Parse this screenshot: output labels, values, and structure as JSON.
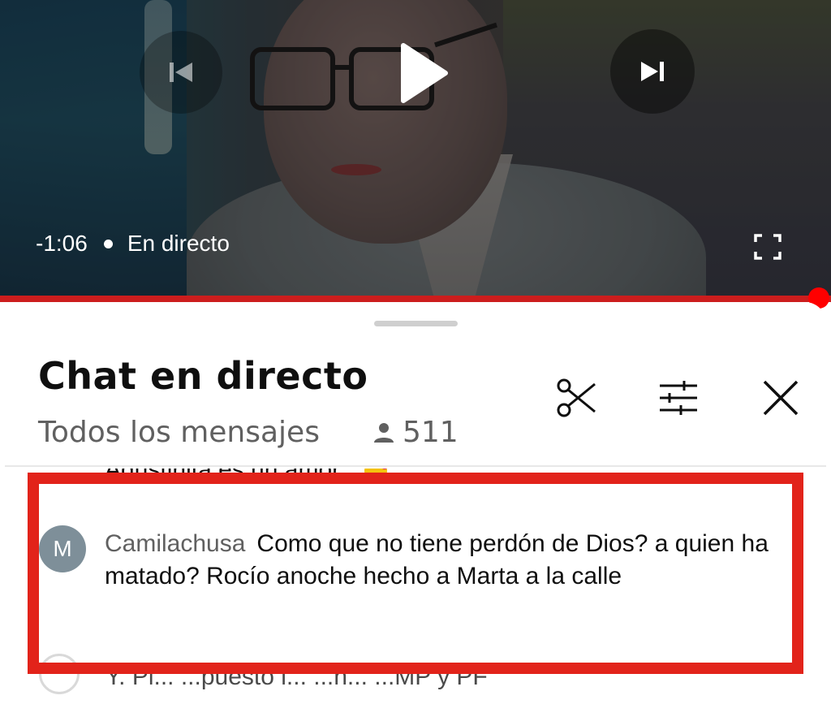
{
  "player": {
    "time_remaining": "-1:06",
    "live_label": "En directo",
    "icons": {
      "prev": "skip-previous-icon",
      "play": "play-icon",
      "next": "skip-next-icon",
      "fullscreen": "fullscreen-icon"
    },
    "progress_color": "#ff0000"
  },
  "chat": {
    "title": "Chat en directo",
    "filter_label": "Todos los mensajes",
    "viewer_count": "511",
    "icons": {
      "viewers": "person-icon",
      "scissors": "scissors-icon",
      "settings": "sliders-icon",
      "close": "close-icon"
    },
    "messages": [
      {
        "author": "",
        "text": "Agustinita es un amor.,",
        "partial": true
      },
      {
        "avatar_letter": "M",
        "author": "Camilachusa",
        "text": "Como que no tiene perdón de Dios? a quien ha matado? Rocío anoche hecho a Marta a la calle"
      },
      {
        "author": "",
        "text": "Y. Pi...  ...puesto l...  ...ñ...  ...MP y PF",
        "partial": true
      }
    ]
  },
  "annotation": {
    "highlight_color": "#e2231a"
  }
}
